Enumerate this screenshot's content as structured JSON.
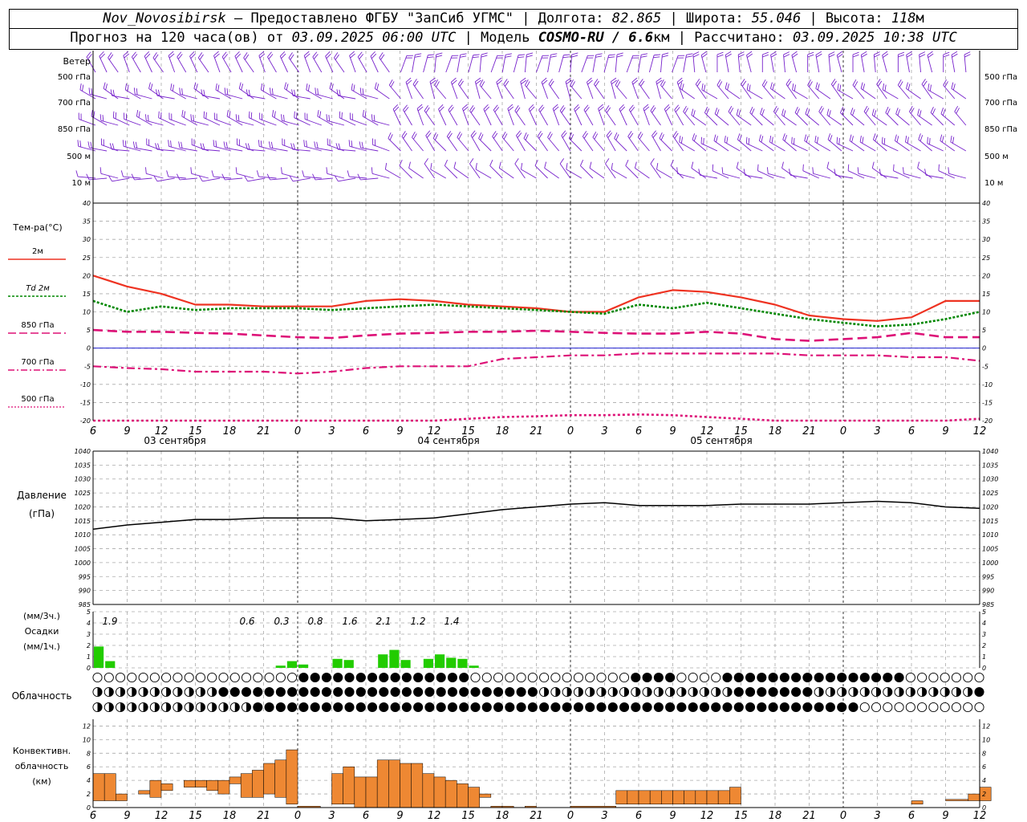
{
  "header": {
    "station": "Nov_Novosibirsk",
    "provided": " – Предоставлено ФГБУ \"ЗапСиб УГМС\" | Долгота: ",
    "lon": "82.865",
    "lat_label": " | Широта: ",
    "lat": "55.046",
    "alt_label": " | Высота: ",
    "alt": "118",
    "alt_unit": "м",
    "forecast_label": "Прогноз на 120 часа(ов) от ",
    "forecast_start": "03.09.2025 06:00 UTC",
    "model_label": " | Модель ",
    "model": "COSMO-RU / 6.6",
    "model_unit": "км",
    "calc_label": " | Рассчитано: ",
    "calc_time": "03.09.2025 10:38 UTC"
  },
  "time_axis": {
    "hour_labels": [
      "6",
      "9",
      "12",
      "15",
      "18",
      "21",
      "0",
      "3",
      "6",
      "9",
      "12",
      "15",
      "18",
      "21",
      "0",
      "3",
      "6",
      "9",
      "12",
      "15",
      "18",
      "21",
      "0",
      "3",
      "6",
      "9",
      "12"
    ],
    "date_labels": [
      "03 сентября",
      "04 сентября",
      "05 сентября"
    ]
  },
  "wind_panel": {
    "title": "Ветер",
    "levels": [
      "500 гПа",
      "700 гПа",
      "850 гПа",
      "500  м",
      "10   м"
    ]
  },
  "temp_panel": {
    "title": "Тем-ра(°C)",
    "legend": [
      "2м",
      "Td  2м",
      "850 гПа",
      "700 гПа",
      "500 гПа"
    ],
    "y_ticks": [
      "40",
      "35",
      "30",
      "25",
      "20",
      "15",
      "10",
      "5",
      "0",
      "-5",
      "-10",
      "-15",
      "-20"
    ],
    "colors": {
      "t2m": "#ee3322",
      "td": "#008800",
      "t850": "#dd1177",
      "t700": "#dd1177",
      "t500": "#dd1177",
      "zero": "#0000cc"
    }
  },
  "pressure_panel": {
    "title": "Давление",
    "unit": "(гПа)",
    "y_ticks": [
      "1040",
      "1035",
      "1030",
      "1025",
      "1020",
      "1015",
      "1010",
      "1005",
      "1000",
      "995",
      "990",
      "985"
    ]
  },
  "precip_panel": {
    "unit_3h": "(мм/3ч.)",
    "title": "Осадки",
    "unit_1h": "(мм/1ч.)",
    "y_ticks": [
      "5",
      "4",
      "3",
      "2",
      "1",
      "0"
    ],
    "totals": [
      "1.9",
      "0.6",
      "0.3",
      "0.8",
      "1.6",
      "2.1",
      "1.2",
      "1.4"
    ],
    "color": "#22cc00"
  },
  "cloud_panel": {
    "title": "Облачность"
  },
  "conv_panel": {
    "title_line1": "Конвективн.",
    "title_line2": "облачность",
    "unit": "(км)",
    "y_ticks": [
      "12",
      "10",
      "8",
      "6",
      "4",
      "2",
      "0"
    ],
    "color": "#ee8833"
  },
  "chart_data": [
    {
      "type": "line",
      "title": "Тем-ра(°C)",
      "x": [
        6,
        9,
        12,
        15,
        18,
        21,
        24,
        27,
        30,
        33,
        36,
        39,
        42,
        45,
        48,
        51,
        54,
        57,
        60,
        63,
        66,
        69,
        72,
        75,
        78,
        81,
        84
      ],
      "x_labels": [
        "6",
        "9",
        "12",
        "15",
        "18",
        "21",
        "0",
        "3",
        "6",
        "9",
        "12",
        "15",
        "18",
        "21",
        "0",
        "3",
        "6",
        "9",
        "12",
        "15",
        "18",
        "21",
        "0",
        "3",
        "6",
        "9",
        "12"
      ],
      "ylim": [
        -20,
        40
      ],
      "series": [
        {
          "name": "2м",
          "values": [
            20,
            17,
            15,
            12,
            12,
            11.5,
            11.5,
            11.5,
            13,
            13.5,
            13,
            12,
            11.5,
            11,
            10,
            10,
            14,
            16,
            15.5,
            14,
            12,
            9,
            8,
            7.5,
            8.5,
            13,
            13
          ]
        },
        {
          "name": "Td  2м",
          "values": [
            13,
            10,
            11.5,
            10.5,
            11,
            11,
            11,
            10.5,
            11,
            11.5,
            12,
            11.5,
            11,
            10.5,
            10,
            9.5,
            12,
            11,
            12.5,
            11,
            9.5,
            8,
            7,
            6,
            6.5,
            8,
            10
          ]
        },
        {
          "name": "850 гПа",
          "values": [
            5,
            4.5,
            4.5,
            4.2,
            4,
            3.5,
            3,
            2.8,
            3.5,
            4,
            4.2,
            4.5,
            4.5,
            4.8,
            4.5,
            4.2,
            4,
            4,
            4.5,
            4,
            2.5,
            2,
            2.5,
            3,
            4.2,
            3,
            3
          ]
        },
        {
          "name": "700 гПа",
          "values": [
            -5,
            -5.5,
            -5.8,
            -6.5,
            -6.5,
            -6.5,
            -7,
            -6.5,
            -5.5,
            -5,
            -5,
            -5,
            -3,
            -2.5,
            -2,
            -2,
            -1.5,
            -1.5,
            -1.5,
            -1.5,
            -1.5,
            -2,
            -2,
            -2,
            -2.5,
            -2.5,
            -3.5
          ]
        },
        {
          "name": "500 гПа",
          "values": [
            -20,
            -21,
            -22,
            -22,
            -22,
            -22,
            -22,
            -22,
            -22,
            -21.5,
            -21,
            -19.5,
            -19,
            -18.8,
            -18.5,
            -18.5,
            -18.3,
            -18.5,
            -19,
            -19.5,
            -20,
            -21,
            -22,
            -22,
            -22,
            -21,
            -19.5
          ]
        }
      ]
    },
    {
      "type": "line",
      "title": "Давление",
      "x": [
        6,
        9,
        12,
        15,
        18,
        21,
        24,
        27,
        30,
        33,
        36,
        39,
        42,
        45,
        48,
        51,
        54,
        57,
        60,
        63,
        66,
        69,
        72,
        75,
        78,
        81,
        84
      ],
      "ylim": [
        985,
        1040
      ],
      "series": [
        {
          "name": "Давление",
          "values": [
            1012,
            1013.5,
            1014.5,
            1015.5,
            1015.5,
            1016,
            1016,
            1016,
            1015,
            1015.5,
            1016,
            1017.5,
            1019,
            1020,
            1021,
            1021.5,
            1020.5,
            1020.5,
            1020.5,
            1021,
            1021,
            1021,
            1021.5,
            1022,
            1021.5,
            1020,
            1019.5
          ]
        }
      ]
    },
    {
      "type": "bar",
      "title": "Осадки",
      "x": [
        6,
        7,
        8,
        22,
        23,
        24,
        27,
        28,
        29,
        31,
        32,
        33,
        35,
        36,
        37,
        38,
        39
      ],
      "values": [
        1.9,
        0.6,
        0,
        0.2,
        0.6,
        0.3,
        0.8,
        0.7,
        0,
        1.2,
        1.6,
        0.7,
        0.8,
        1.2,
        0.9,
        0.8,
        0.2
      ],
      "ylim": [
        0,
        5
      ]
    },
    {
      "type": "bar",
      "title": "Конвективн. облачность",
      "ylim": [
        0,
        13
      ],
      "bars": [
        {
          "x0": 6,
          "x1": 7,
          "lo": 1,
          "hi": 5
        },
        {
          "x0": 7,
          "x1": 8,
          "lo": 1,
          "hi": 5
        },
        {
          "x0": 8,
          "x1": 9,
          "lo": 1,
          "hi": 2
        },
        {
          "x0": 10,
          "x1": 11,
          "lo": 2,
          "hi": 2.5
        },
        {
          "x0": 11,
          "x1": 12,
          "lo": 1.5,
          "hi": 4
        },
        {
          "x0": 12,
          "x1": 13,
          "lo": 2.5,
          "hi": 3.5
        },
        {
          "x0": 14,
          "x1": 15,
          "lo": 3,
          "hi": 4
        },
        {
          "x0": 15,
          "x1": 16,
          "lo": 3,
          "hi": 4
        },
        {
          "x0": 16,
          "x1": 17,
          "lo": 2.5,
          "hi": 4
        },
        {
          "x0": 17,
          "x1": 18,
          "lo": 2,
          "hi": 4
        },
        {
          "x0": 18,
          "x1": 19,
          "lo": 3.5,
          "hi": 4.5
        },
        {
          "x0": 19,
          "x1": 20,
          "lo": 1.5,
          "hi": 5
        },
        {
          "x0": 20,
          "x1": 21,
          "lo": 1.5,
          "hi": 5.5
        },
        {
          "x0": 21,
          "x1": 22,
          "lo": 2,
          "hi": 6.5
        },
        {
          "x0": 22,
          "x1": 23,
          "lo": 1.5,
          "hi": 7
        },
        {
          "x0": 23,
          "x1": 24,
          "lo": 0.5,
          "hi": 8.5
        },
        {
          "x0": 24,
          "x1": 26,
          "lo": 0,
          "hi": 0.2
        },
        {
          "x0": 27,
          "x1": 28,
          "lo": 0.5,
          "hi": 5
        },
        {
          "x0": 28,
          "x1": 29,
          "lo": 0.5,
          "hi": 6
        },
        {
          "x0": 29,
          "x1": 30,
          "lo": 0,
          "hi": 4.5
        },
        {
          "x0": 30,
          "x1": 31,
          "lo": 0,
          "hi": 4.5
        },
        {
          "x0": 31,
          "x1": 32,
          "lo": 0,
          "hi": 7
        },
        {
          "x0": 32,
          "x1": 33,
          "lo": 0,
          "hi": 7
        },
        {
          "x0": 33,
          "x1": 34,
          "lo": 0,
          "hi": 6.5
        },
        {
          "x0": 34,
          "x1": 35,
          "lo": 0,
          "hi": 6.5
        },
        {
          "x0": 35,
          "x1": 36,
          "lo": 0,
          "hi": 5
        },
        {
          "x0": 36,
          "x1": 37,
          "lo": 0,
          "hi": 4.5
        },
        {
          "x0": 37,
          "x1": 38,
          "lo": 0,
          "hi": 4
        },
        {
          "x0": 38,
          "x1": 39,
          "lo": 0,
          "hi": 3.5
        },
        {
          "x0": 39,
          "x1": 40,
          "lo": 0,
          "hi": 3
        },
        {
          "x0": 40,
          "x1": 41,
          "lo": 1.5,
          "hi": 2
        },
        {
          "x0": 41,
          "x1": 42,
          "lo": 0,
          "hi": 0.2
        },
        {
          "x0": 42,
          "x1": 43,
          "lo": 0,
          "hi": 0.2
        },
        {
          "x0": 44,
          "x1": 45,
          "lo": 0,
          "hi": 0.2
        },
        {
          "x0": 48,
          "x1": 52,
          "lo": 0,
          "hi": 0.2
        },
        {
          "x0": 52,
          "x1": 53,
          "lo": 0.5,
          "hi": 2.5
        },
        {
          "x0": 53,
          "x1": 54,
          "lo": 0.5,
          "hi": 2.5
        },
        {
          "x0": 54,
          "x1": 55,
          "lo": 0.5,
          "hi": 2.5
        },
        {
          "x0": 55,
          "x1": 56,
          "lo": 0.5,
          "hi": 2.5
        },
        {
          "x0": 56,
          "x1": 57,
          "lo": 0.5,
          "hi": 2.5
        },
        {
          "x0": 57,
          "x1": 58,
          "lo": 0.5,
          "hi": 2.5
        },
        {
          "x0": 58,
          "x1": 59,
          "lo": 0.5,
          "hi": 2.5
        },
        {
          "x0": 59,
          "x1": 60,
          "lo": 0.5,
          "hi": 2.5
        },
        {
          "x0": 60,
          "x1": 61,
          "lo": 0.5,
          "hi": 2.5
        },
        {
          "x0": 61,
          "x1": 62,
          "lo": 0.5,
          "hi": 2.5
        },
        {
          "x0": 62,
          "x1": 63,
          "lo": 0.5,
          "hi": 3
        },
        {
          "x0": 78,
          "x1": 79,
          "lo": 0.5,
          "hi": 1
        },
        {
          "x0": 81,
          "x1": 83,
          "lo": 1,
          "hi": 1.2
        },
        {
          "x0": 83,
          "x1": 84,
          "lo": 1,
          "hi": 2
        },
        {
          "x0": 84,
          "x1": 85,
          "lo": 1,
          "hi": 3
        }
      ]
    }
  ]
}
